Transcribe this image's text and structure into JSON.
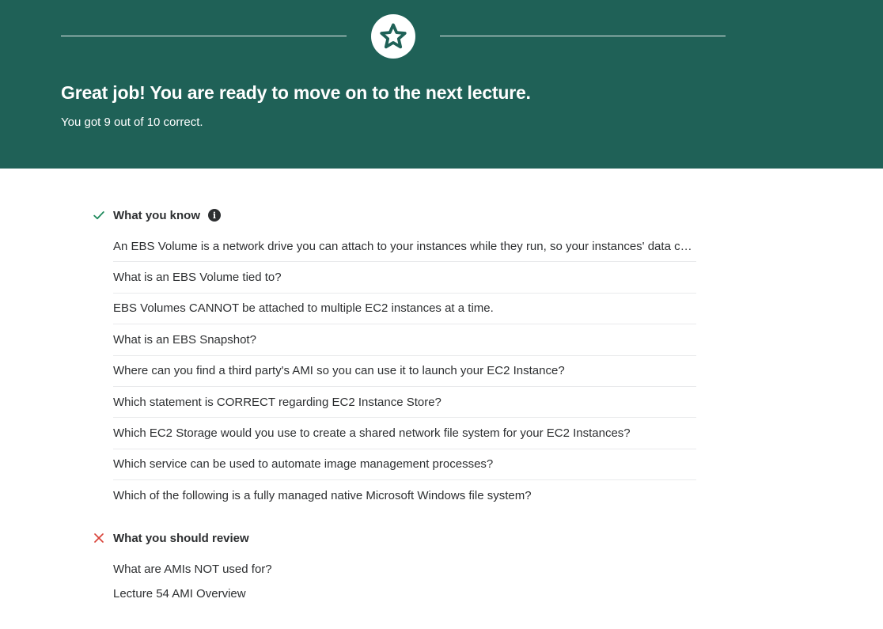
{
  "hero": {
    "title": "Great job! You are ready to move on to the next lecture.",
    "subtitle": "You got 9 out of 10 correct.",
    "icon": "star-icon",
    "background_color": "#1f6157"
  },
  "know_section": {
    "heading": "What you know",
    "status_icon": "check-icon",
    "status_color": "#1f8a5c",
    "info_icon": "info-icon",
    "items": [
      {
        "text": "An EBS Volume is a network drive you can attach to your instances while they run, so your instances' data can persist even after their termination"
      },
      {
        "text": "What is an EBS Volume tied to?"
      },
      {
        "text": "EBS Volumes CANNOT be attached to multiple EC2 instances at a time."
      },
      {
        "text": "What is an EBS Snapshot?"
      },
      {
        "text": "Where can you find a third party's AMI so you can use it to launch your EC2 Instance?"
      },
      {
        "text": "Which statement is CORRECT regarding EC2 Instance Store?"
      },
      {
        "text": "Which EC2 Storage would you use to create a shared network file system for your EC2 Instances?"
      },
      {
        "text": "Which service can be used to automate image management processes?"
      },
      {
        "text": "Which of the following is a fully managed native Microsoft Windows file system?"
      }
    ]
  },
  "review_section": {
    "heading": "What you should review",
    "status_icon": "x-icon",
    "status_color": "#d9443b",
    "items": [
      {
        "text": "What are AMIs NOT used for?"
      },
      {
        "text": "Lecture 54 AMI Overview"
      }
    ]
  }
}
